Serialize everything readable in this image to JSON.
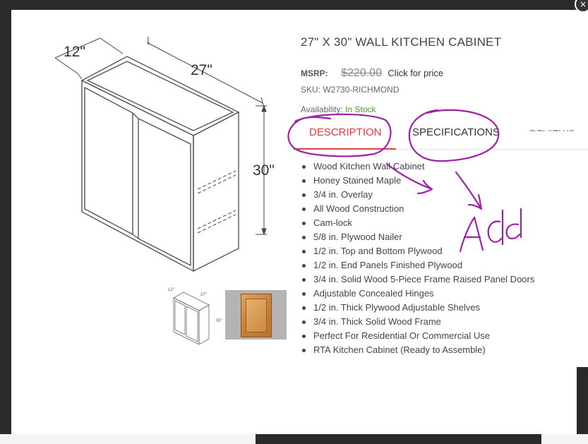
{
  "modal": {
    "close_icon": "×"
  },
  "product": {
    "title": "27\" X 30\" WALL KITCHEN CABINET",
    "msrp_label": "MSRP:",
    "msrp_price": "$220.00",
    "click_for_price": "Click for price",
    "sku": "SKU: W2730-RICHMOND",
    "availability_label": "Availability: ",
    "availability_value": "In Stock",
    "availability_color": "#4a9a2a"
  },
  "image": {
    "depth_label": "12\"",
    "width_label": "27\"",
    "height_label": "30\"",
    "thumb_depth": "12\"",
    "thumb_width": "27\"",
    "thumb_height": "30\""
  },
  "tabs": [
    {
      "label": "DESCRIPTION",
      "active": true
    },
    {
      "label": "SPECIFICATIONS",
      "active": false
    },
    {
      "label": "REVIEWS",
      "active": false
    }
  ],
  "features": [
    "Wood Kitchen Wall Cabinet",
    "Honey Stained Maple",
    "3/4 in. Overlay",
    "All Wood Construction",
    "Cam-lock",
    "5/8 in. Plywood Nailer",
    "1/2 in. Top and Bottom Plywood",
    "1/2 in. End Panels Finished Plywood",
    "3/4 in. Solid Wood 5-Piece Frame Raised Panel Doors",
    "Adjustable Concealed Hinges",
    "1/2 in. Thick Plywood Adjustable Shelves",
    "3/4 in. Thick Solid Wood Frame",
    "Perfect For Residential Or Commercial Use",
    "RTA Kitchen Cabinet (Ready to Assemble)"
  ],
  "annotation": {
    "text": "Add",
    "color": "#a020a8"
  },
  "colors": {
    "accent": "#e43a3a",
    "ink": "#444444"
  }
}
